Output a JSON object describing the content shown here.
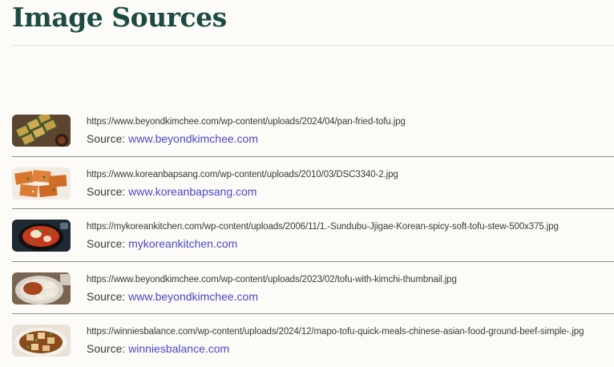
{
  "page": {
    "title": "Image Sources"
  },
  "source_label": "Source:",
  "sources": [
    {
      "url": "https://www.beyondkimchee.com/wp-content/uploads/2024/04/pan-fried-tofu.jpg",
      "site": "www.beyondkimchee.com",
      "thumbnail_icon": "pan-fried-tofu-image"
    },
    {
      "url": "https://www.koreanbapsang.com/wp-content/uploads/2010/03/DSC3340-2.jpg",
      "site": "www.koreanbapsang.com",
      "thumbnail_icon": "spicy-tofu-image"
    },
    {
      "url": "https://mykoreankitchen.com/wp-content/uploads/2006/11/1.-Sundubu-Jjigae-Korean-spicy-soft-tofu-stew-500x375.jpg",
      "site": "mykoreankitchen.com",
      "thumbnail_icon": "sundubu-stew-image"
    },
    {
      "url": "https://www.beyondkimchee.com/wp-content/uploads/2023/02/tofu-with-kimchi-thumbnail.jpg",
      "site": "www.beyondkimchee.com",
      "thumbnail_icon": "tofu-kimchi-image"
    },
    {
      "url": "https://winniesbalance.com/wp-content/uploads/2024/12/mapo-tofu-quick-meals-chinese-asian-food-ground-beef-simple-.jpg",
      "site": "winniesbalance.com",
      "thumbnail_icon": "mapo-tofu-image"
    }
  ],
  "colors": {
    "title": "#1d4a42",
    "link": "#4d48c9",
    "background": "#fcfbf7"
  }
}
